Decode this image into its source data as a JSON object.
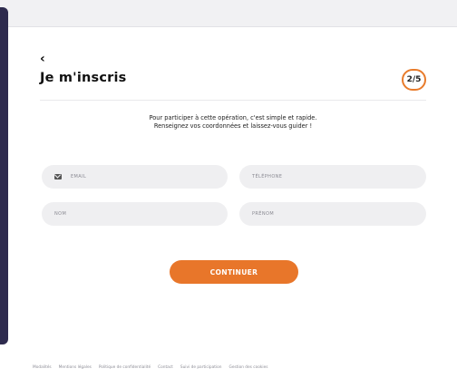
{
  "header": {
    "back_label": "‹",
    "title": "Je m'inscris",
    "step": "2/5"
  },
  "intro": {
    "line1": "Pour participer à cette opération, c'est simple et rapide.",
    "line2": "Renseignez vos coordonnées et laissez-vous guider !"
  },
  "form": {
    "email_placeholder": "EMAIL",
    "phone_placeholder": "TÉLÉPHONE",
    "lastname_placeholder": "NOM",
    "firstname_placeholder": "PRÉNOM",
    "submit_label": "CONTINUER"
  },
  "footer": {
    "links": [
      "Modalités",
      "Mentions légales",
      "Politique de confidentialité",
      "Contact",
      "Suivi de participation",
      "Gestion des cookies"
    ]
  },
  "colors": {
    "accent": "#e8762a",
    "sidebar_edge": "#2e2b4e",
    "field_bg": "#efeff1"
  },
  "icons": {
    "email": "mail-icon"
  }
}
